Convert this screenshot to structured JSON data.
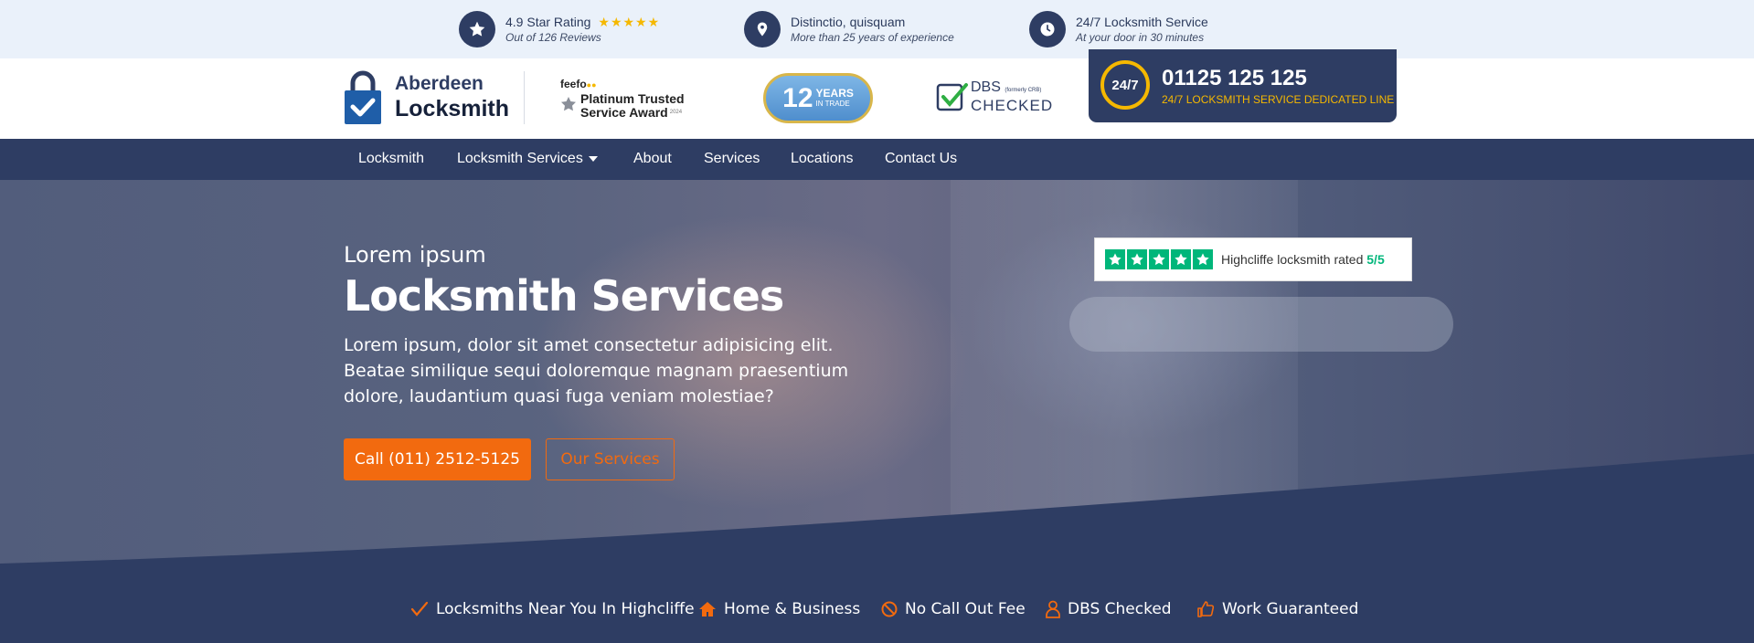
{
  "topbar": {
    "rating": {
      "title": "4.9 Star Rating",
      "subtitle": "Out of 126 Reviews",
      "stars": "★★★★★",
      "icon": "star-icon"
    },
    "experience": {
      "title": "Distinctio, quisquam",
      "subtitle": "More than 25 years of experience",
      "icon": "map-pin-icon"
    },
    "service": {
      "title": "24/7 Locksmith Service",
      "subtitle": "At your door in 30 minutes",
      "icon": "clock-icon"
    }
  },
  "header": {
    "logo_line1": "Aberdeen",
    "logo_line2": "Locksmith",
    "feefo_brand": "feefo",
    "feefo_award_line1": "Platinum Trusted",
    "feefo_award_line2": "Service Award",
    "feefo_year": "2024",
    "years_number": "12",
    "years_word": "YEARS",
    "years_sub": "IN TRADE",
    "dbs_title": "DBS",
    "dbs_formerly": "(formerly CRB)",
    "dbs_checked": "CHECKED",
    "phone_badge": "24/7",
    "phone_number": "01125 125 125",
    "phone_sub": "24/7 LOCKSMITH SERVICE DEDICATED LINE"
  },
  "nav": {
    "items": [
      "Locksmith",
      "Locksmith Services",
      "About",
      "Services",
      "Locations",
      "Contact Us"
    ]
  },
  "hero": {
    "subtitle": "Lorem ipsum",
    "title": "Locksmith Services",
    "text": "Lorem ipsum, dolor sit amet consectetur adipisicing elit. Beatae similique sequi doloremque magnam praesentium dolore, laudantium quasi fuga veniam molestiae?",
    "call_button": "Call (011) 2512-5125",
    "services_button": "Our Services",
    "rating_text": "Highcliffe locksmith rated",
    "rating_value": "5/5"
  },
  "features": [
    {
      "label": "Locksmiths Near You In Highcliffe",
      "icon": "check-icon"
    },
    {
      "label": "Home & Business",
      "icon": "home-icon"
    },
    {
      "label": "No Call Out Fee",
      "icon": "ban-icon"
    },
    {
      "label": "DBS Checked",
      "icon": "user-icon"
    },
    {
      "label": "Work Guaranteed",
      "icon": "thumbs-up-icon"
    }
  ],
  "colors": {
    "navy": "#2e3d63",
    "orange": "#f26a0f",
    "gold": "#f5b800",
    "trustpilot_green": "#00b67a",
    "topbar_bg": "#eaf1fa"
  }
}
